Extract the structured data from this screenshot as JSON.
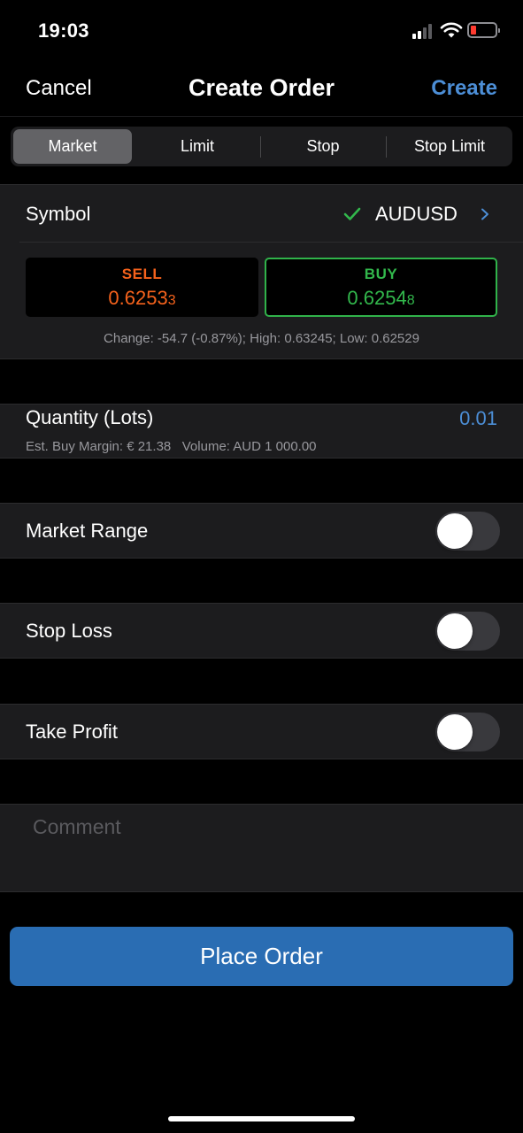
{
  "status": {
    "time": "19:03",
    "battery_color": "#ff3b30"
  },
  "nav": {
    "cancel": "Cancel",
    "title": "Create Order",
    "create": "Create"
  },
  "order_types": [
    "Market",
    "Limit",
    "Stop",
    "Stop Limit"
  ],
  "order_type_selected": "Market",
  "symbol": {
    "label": "Symbol",
    "value": "AUDUSD",
    "check_icon": "checkmark-icon",
    "chevron_icon": "chevron-right-icon"
  },
  "sell": {
    "label": "SELL",
    "price_main": "0.6253",
    "price_pip": "3",
    "color": "#f5621c"
  },
  "buy": {
    "label": "BUY",
    "price_main": "0.6254",
    "price_pip": "8",
    "color": "#32b84c"
  },
  "change_text": "Change: -54.7 (-0.87%); High: 0.63245; Low: 0.62529",
  "quantity": {
    "label": "Quantity (Lots)",
    "value": "0.01",
    "margin_text": "Est. Buy Margin: € 21.38   Volume: AUD 1 000.00"
  },
  "toggles": {
    "market_range": {
      "label": "Market Range",
      "on": false
    },
    "stop_loss": {
      "label": "Stop Loss",
      "on": false
    },
    "take_profit": {
      "label": "Take Profit",
      "on": false
    }
  },
  "comment": {
    "placeholder": "Comment"
  },
  "place_order": "Place Order",
  "colors": {
    "accent": "#4c8ed6",
    "button": "#2a6db3"
  }
}
